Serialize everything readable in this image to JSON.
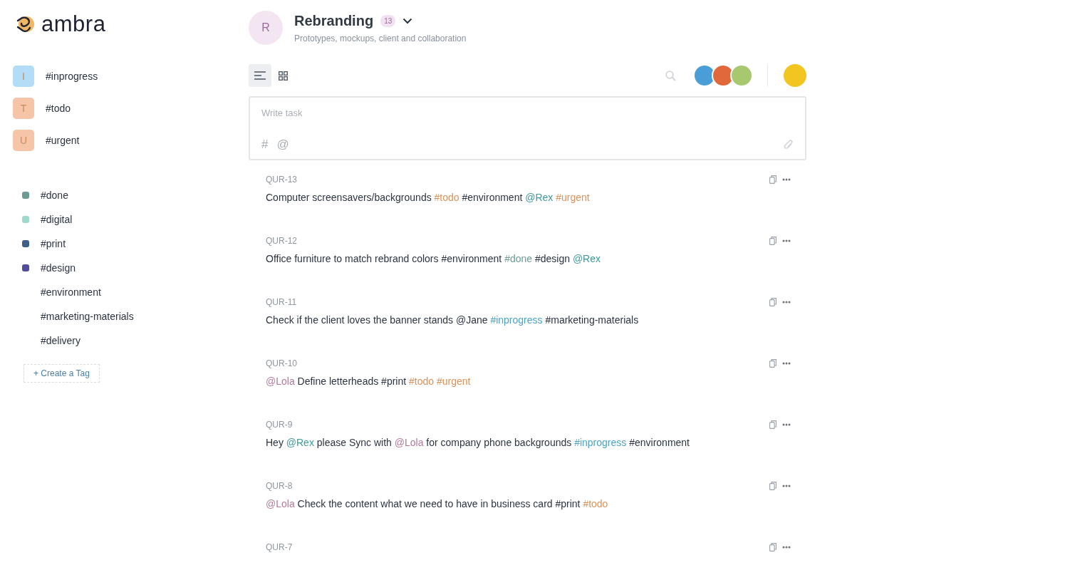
{
  "logo": {
    "text": "ambra"
  },
  "pinned_tags": [
    {
      "letter": "I",
      "label": "#inprogress",
      "color": "#b3dcf7"
    },
    {
      "letter": "T",
      "label": "#todo",
      "color": "#f6c4a6"
    },
    {
      "letter": "U",
      "label": "#urgent",
      "color": "#f6c4a6"
    }
  ],
  "tags": [
    {
      "label": "#done",
      "color": "#6f9a94"
    },
    {
      "label": "#digital",
      "color": "#9fd9cc"
    },
    {
      "label": "#print",
      "color": "#3e6087"
    },
    {
      "label": "#design",
      "color": "#4e4c9b"
    },
    {
      "label": "#environment"
    },
    {
      "label": "#marketing-materials"
    },
    {
      "label": "#delivery"
    }
  ],
  "create_tag": "+ Create a Tag",
  "project": {
    "initial": "R",
    "title": "Rebranding",
    "count": "13",
    "subtitle": "Prototypes, mockups, client and collaboration"
  },
  "view_toggle": [
    {
      "kind": "list",
      "selected": true
    },
    {
      "kind": "grid",
      "selected": false
    }
  ],
  "members": [
    {
      "color": "#4a9ed8"
    },
    {
      "color": "#e0683a"
    },
    {
      "color": "#a8c870"
    }
  ],
  "current_user": {
    "color": "#f2c520"
  },
  "composer": {
    "placeholder": "Write task",
    "hash": "#",
    "at": "@"
  },
  "tasks": [
    {
      "id": "QUR-13",
      "segments": [
        {
          "text": "Computer screensavers/backgrounds "
        },
        {
          "text": "#todo",
          "color": "#d9925a"
        },
        {
          "text": " #environment "
        },
        {
          "text": "@Rex ",
          "color": "#3c9a9a"
        },
        {
          "text": "#urgent",
          "color": "#d9925a"
        }
      ]
    },
    {
      "id": "QUR-12",
      "segments": [
        {
          "text": "Office furniture to match rebrand colors #environment "
        },
        {
          "text": "#done",
          "color": "#6f9a94"
        },
        {
          "text": " #design "
        },
        {
          "text": "@Rex",
          "color": "#3c9a9a"
        }
      ]
    },
    {
      "id": "QUR-11",
      "segments": [
        {
          "text": "Check if the client loves the banner stands @Jane "
        },
        {
          "text": "#inprogress",
          "color": "#4aa3c9"
        },
        {
          "text": " #marketing-materials"
        }
      ]
    },
    {
      "id": "QUR-10",
      "segments": [
        {
          "text": "@Lola",
          "color": "#b07a9a"
        },
        {
          "text": " Define letterheads #print "
        },
        {
          "text": "#todo ",
          "color": "#d9925a"
        },
        {
          "text": "#urgent",
          "color": "#d9925a"
        }
      ]
    },
    {
      "id": "QUR-9",
      "segments": [
        {
          "text": "Hey "
        },
        {
          "text": "@Rex",
          "color": "#3c9a9a"
        },
        {
          "text": " please Sync with "
        },
        {
          "text": "@Lola",
          "color": "#b07a9a"
        },
        {
          "text": " for company phone backgrounds "
        },
        {
          "text": "#inprogress",
          "color": "#4aa3c9"
        },
        {
          "text": " #environment"
        }
      ]
    },
    {
      "id": "QUR-8",
      "segments": [
        {
          "text": "@Lola",
          "color": "#b07a9a"
        },
        {
          "text": " Check the content what we need to have in business card #print "
        },
        {
          "text": "#todo",
          "color": "#d9925a"
        }
      ]
    },
    {
      "id": "QUR-7"
    }
  ]
}
